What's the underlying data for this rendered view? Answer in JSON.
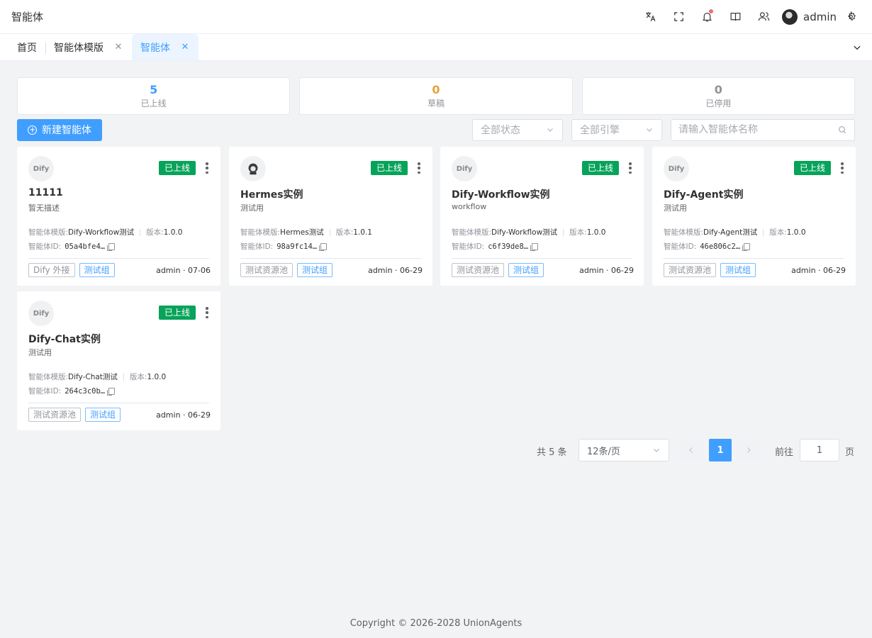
{
  "header": {
    "title": "智能体",
    "icons": [
      "translate-icon",
      "fullscreen-icon",
      "bell-icon",
      "book-icon",
      "users-icon"
    ],
    "user_name": "admin",
    "notification_dot_color": "#f56c6c"
  },
  "tabs": [
    {
      "label": "首页",
      "closable": false,
      "active": false
    },
    {
      "label": "智能体模版",
      "closable": true,
      "active": false
    },
    {
      "label": "智能体",
      "closable": true,
      "active": true
    }
  ],
  "stats": [
    {
      "value": "5",
      "label": "已上线",
      "color": "#409eff"
    },
    {
      "value": "0",
      "label": "草稿",
      "color": "#e6a23c"
    },
    {
      "value": "0",
      "label": "已停用",
      "color": "#909399"
    }
  ],
  "toolbar": {
    "new_button": "新建智能体",
    "status_select": "全部状态",
    "engine_select": "全部引擎",
    "search_placeholder": "请输入智能体名称"
  },
  "card_labels": {
    "template_prefix": "智能体模版:",
    "version_prefix": "版本:",
    "id_prefix": "智能体ID:",
    "dify_logo": "Dify"
  },
  "cards": [
    {
      "name": "11111",
      "desc": "暂无描述",
      "status": "已上线",
      "template": "Dify-Workflow测试",
      "version": "1.0.0",
      "id": "05a4bfe4…",
      "tags": [
        {
          "label": "Dify 外接",
          "style": "gray"
        },
        {
          "label": "测试组",
          "style": "blue"
        }
      ],
      "footer": "admin · 07-06",
      "logo": "dify"
    },
    {
      "name": "Hermes实例",
      "desc": "测试用",
      "status": "已上线",
      "template": "Hermes测试",
      "version": "1.0.1",
      "id": "98a9fc14…",
      "tags": [
        {
          "label": "测试资源池",
          "style": "gray"
        },
        {
          "label": "测试组",
          "style": "blue"
        }
      ],
      "footer": "admin · 06-29",
      "logo": "hermes"
    },
    {
      "name": "Dify-Workflow实例",
      "desc": "workflow",
      "status": "已上线",
      "template": "Dify-Workflow测试",
      "version": "1.0.0",
      "id": "c6f39de8…",
      "tags": [
        {
          "label": "测试资源池",
          "style": "gray"
        },
        {
          "label": "测试组",
          "style": "blue"
        }
      ],
      "footer": "admin · 06-29",
      "logo": "dify"
    },
    {
      "name": "Dify-Agent实例",
      "desc": "测试用",
      "status": "已上线",
      "template": "Dify-Agent测试",
      "version": "1.0.0",
      "id": "46e806c2…",
      "tags": [
        {
          "label": "测试资源池",
          "style": "gray"
        },
        {
          "label": "测试组",
          "style": "blue"
        }
      ],
      "footer": "admin · 06-29",
      "logo": "dify"
    },
    {
      "name": "Dify-Chat实例",
      "desc": "测试用",
      "status": "已上线",
      "template": "Dify-Chat测试",
      "version": "1.0.0",
      "id": "264c3c0b…",
      "tags": [
        {
          "label": "测试资源池",
          "style": "gray"
        },
        {
          "label": "测试组",
          "style": "blue"
        }
      ],
      "footer": "admin · 06-29",
      "logo": "dify"
    }
  ],
  "pagination": {
    "total": "共 5 条",
    "page_size": "12条/页",
    "current_page": "1",
    "goto_label": "前往",
    "goto_value": "1",
    "page_unit": "页"
  },
  "footer": "Copyright © 2026-2028 UnionAgents"
}
